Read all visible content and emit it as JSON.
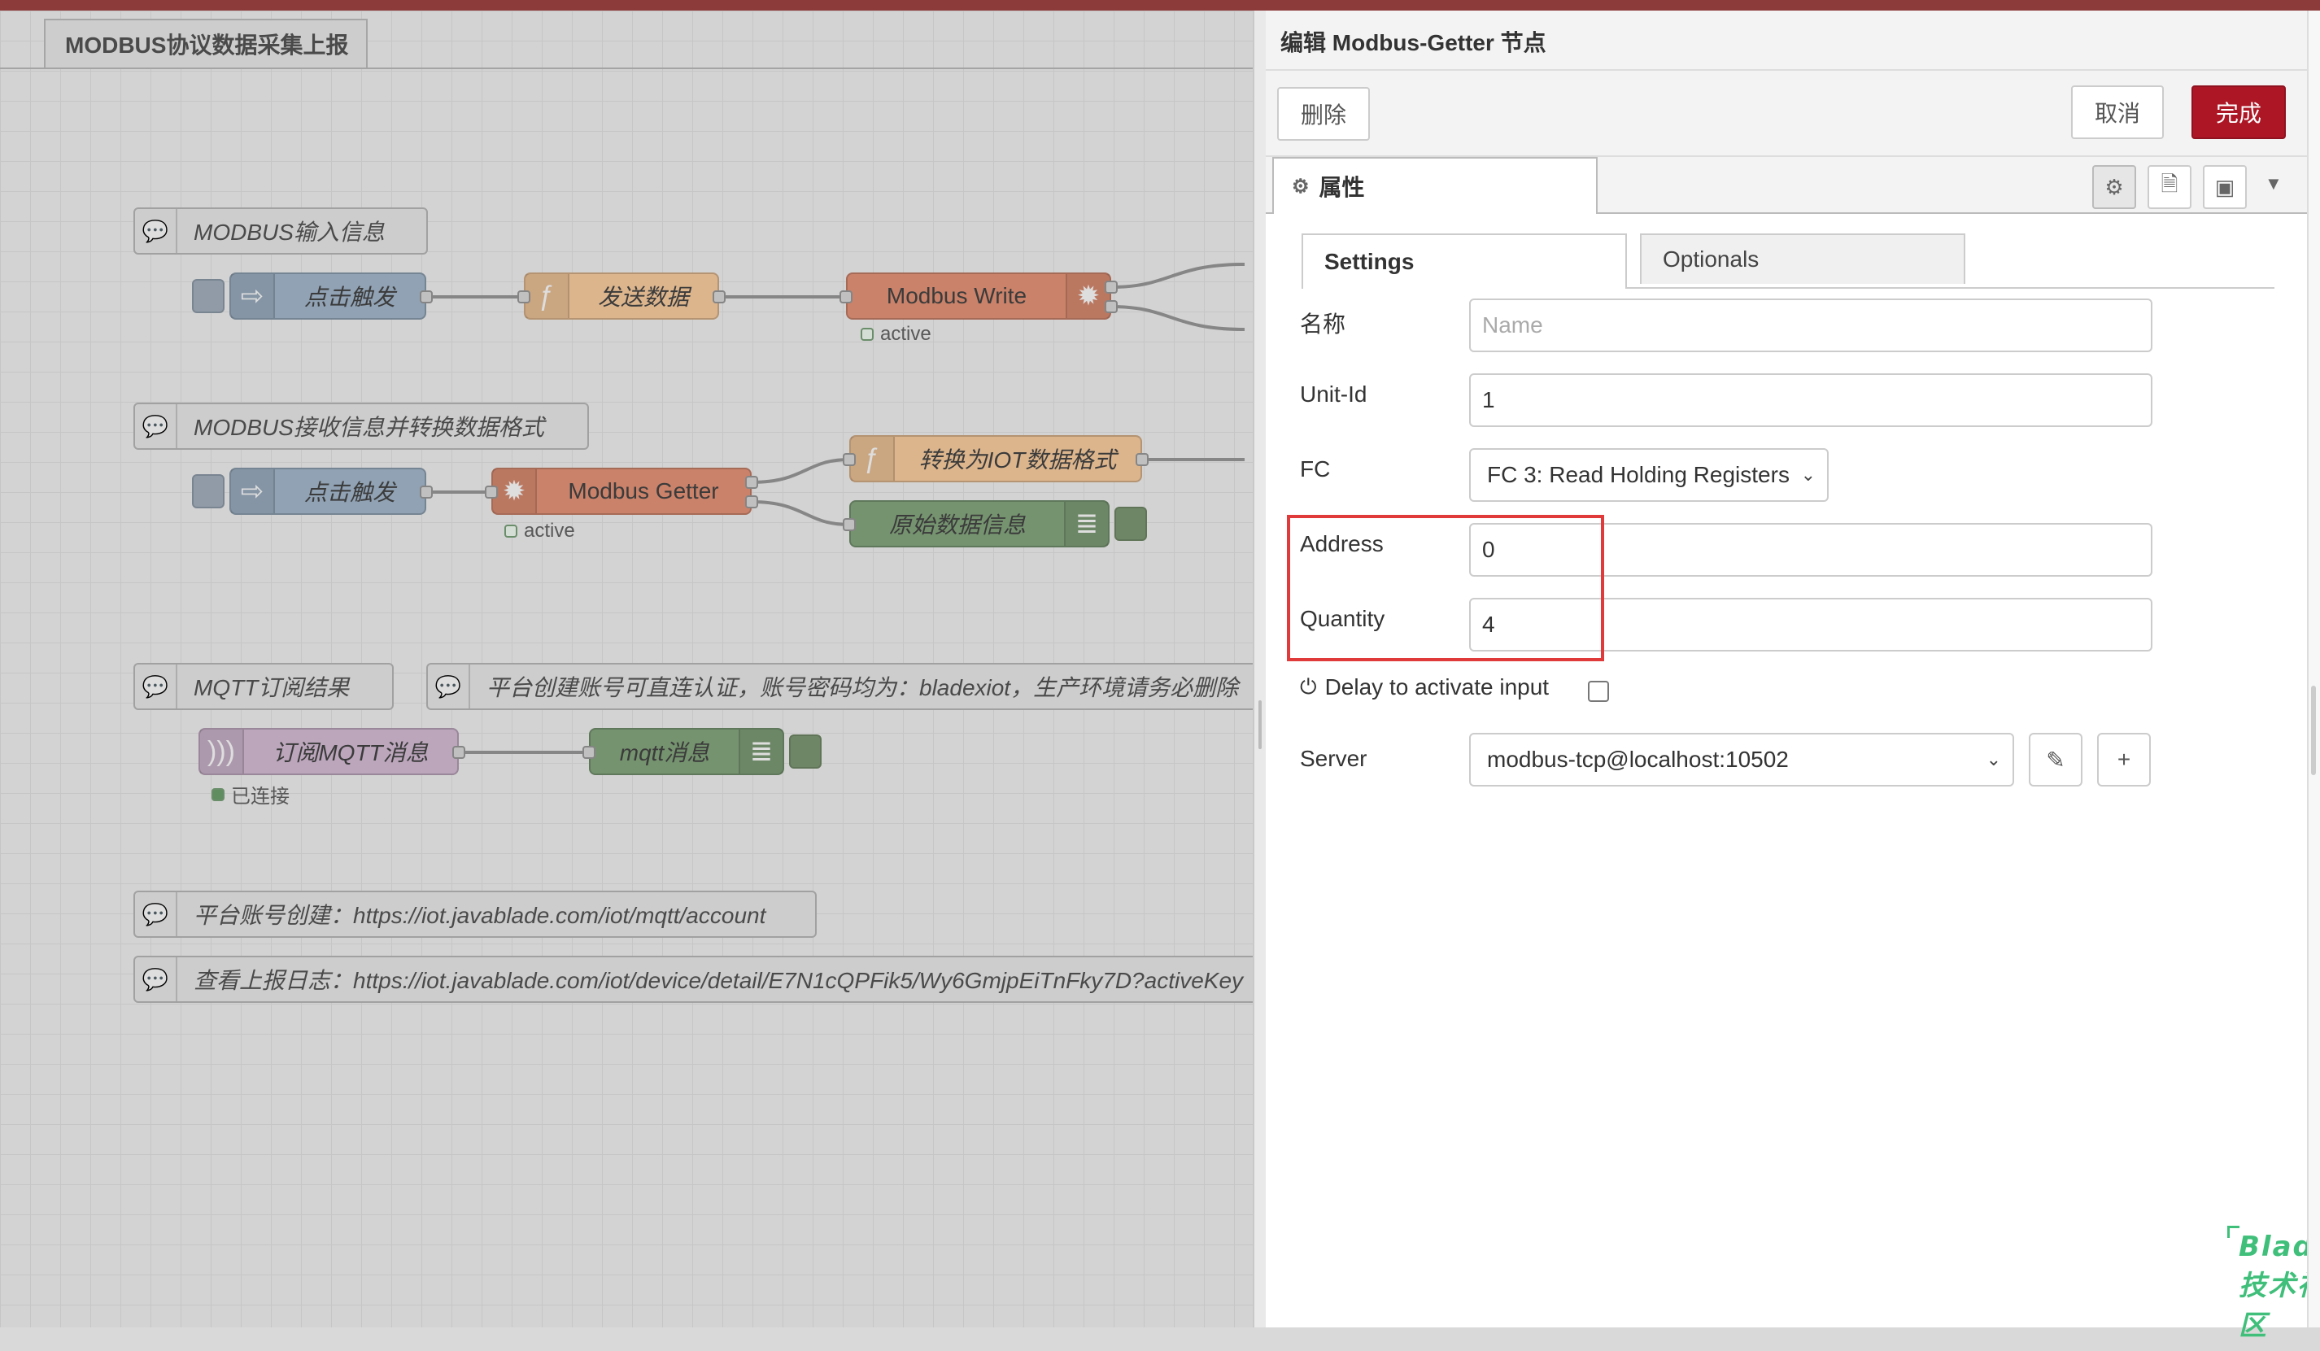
{
  "canvas": {
    "flow_tab": "MODBUS协议数据采集上报",
    "comments": {
      "input_info": "MODBUS输入信息",
      "receive_convert": "MODBUS接收信息并转换数据格式",
      "mqtt_result": "MQTT订阅结果",
      "platform_note": "平台创建账号可直连认证，账号密码均为：bladexiot，生产环境请务必删除",
      "account_create": "平台账号创建：https://iot.javablade.com/iot/mqtt/account",
      "report_log": "查看上报日志：https://iot.javablade.com/iot/device/detail/E7N1cQPFik5/Wy6GmjpEiTnFky7D?activeKey"
    },
    "nodes": {
      "inject1": "点击触发",
      "send_data": "发送数据",
      "modbus_write": "Modbus Write",
      "modbus_write_status": "active",
      "inject2": "点击触发",
      "modbus_getter": "Modbus Getter",
      "modbus_getter_status": "active",
      "convert_iot": "转换为IOT数据格式",
      "raw_data": "原始数据信息",
      "mqtt_in": "订阅MQTT消息",
      "mqtt_in_status": "已连接",
      "mqtt_debug": "mqtt消息"
    }
  },
  "editor": {
    "title": "编辑 Modbus-Getter 节点",
    "delete_label": "删除",
    "cancel_label": "取消",
    "done_label": "完成",
    "properties_tab": "属性",
    "settings_tab": "Settings",
    "optionals_tab": "Optionals",
    "form": {
      "name_label": "名称",
      "name_placeholder": "Name",
      "unit_id_label": "Unit-Id",
      "unit_id_value": "1",
      "fc_label": "FC",
      "fc_value": "FC 3: Read Holding Registers",
      "address_label": "Address",
      "address_value": "0",
      "quantity_label": "Quantity",
      "quantity_value": "4",
      "delay_label": "Delay to activate input",
      "delay_checked": false,
      "server_label": "Server",
      "server_value": "modbus-tcp@localhost:10502"
    },
    "icons": [
      "gear-icon",
      "document-icon",
      "appearance-icon",
      "caret-down-icon",
      "pencil-icon",
      "plus-icon",
      "power-icon"
    ]
  },
  "watermark": "Blade技术社区",
  "colors": {
    "topbar": "#8c3a3a",
    "done_button": "#ad1625",
    "highlight": "#e03a3a",
    "function_node": "#fdd0a2",
    "modbus_node": "#e9967a",
    "inject_node": "#a6bbcf",
    "debug_node": "#87a980",
    "mqtt_node": "#d8bfd8"
  }
}
